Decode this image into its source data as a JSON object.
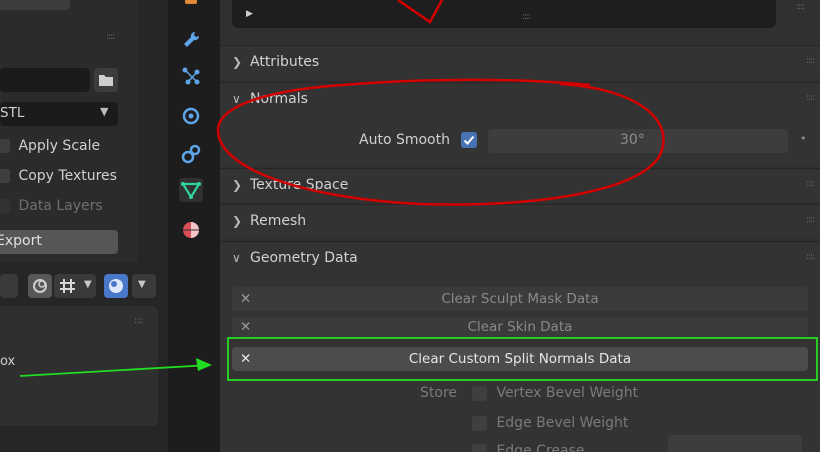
{
  "left_panel": {
    "format_value": "STL",
    "checkboxes": [
      {
        "label": "Apply Scale",
        "enabled": true
      },
      {
        "label": "Copy Textures",
        "enabled": true
      },
      {
        "label": "Data Layers",
        "enabled": false
      }
    ],
    "export_label": "Export",
    "bottom_text": "ox"
  },
  "tabs": [
    "tool-wrench-icon",
    "particles-icon",
    "physics-icon",
    "constraints-icon",
    "object-data-icon",
    "material-icon"
  ],
  "properties": {
    "sections": {
      "attributes": "Attributes",
      "normals": "Normals",
      "texture_space": "Texture Space",
      "remesh": "Remesh",
      "geometry_data": "Geometry Data"
    },
    "auto_smooth": {
      "label": "Auto Smooth",
      "checked": true,
      "angle": "30°"
    },
    "geometry_buttons": [
      {
        "label": "Clear Sculpt Mask Data",
        "active": false
      },
      {
        "label": "Clear Skin Data",
        "active": false
      },
      {
        "label": "Clear Custom Split Normals Data",
        "active": true
      }
    ],
    "store": {
      "label": "Store",
      "options": [
        "Vertex Bevel Weight",
        "Edge Bevel Weight",
        "Edge Crease"
      ]
    }
  },
  "annotations": {
    "circle_color": "#d40000",
    "highlight_color": "#22dd22"
  }
}
